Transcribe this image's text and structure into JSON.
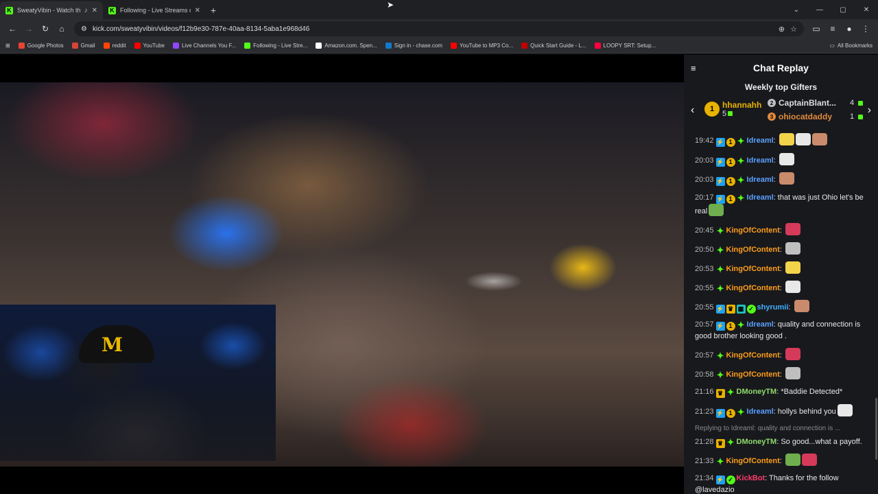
{
  "tabs": [
    {
      "title": "SweatyVibin - Watch the V",
      "active": true
    },
    {
      "title": "Following - Live Streams on Kic",
      "active": false
    }
  ],
  "url": "kick.com/sweatyvibin/videos/f12b9e30-787e-40aa-8134-5aba1e968d46",
  "bookmarks": [
    "Google Photos",
    "Gmail",
    "reddit",
    "YouTube",
    "Live Channels You F...",
    "Following - Live Stre...",
    "Amazon.com. Spen...",
    "Sign in - chase.com",
    "YouTube to MP3 Co...",
    "Quick Start Guide - L...",
    "LOOPY SRT: Setup..."
  ],
  "bookmark_colors": [
    "#ea4335",
    "#d44638",
    "#ff4500",
    "#ff0000",
    "#9146ff",
    "#53fc18",
    "#ffffff",
    "#117aca",
    "#ff0000",
    "#c00000",
    "#ff0040"
  ],
  "all_bookmarks": "All Bookmarks",
  "chat": {
    "title": "Chat Replay",
    "gifters_title": "Weekly top Gifters",
    "gifters": [
      {
        "rank": "1",
        "name": "hhannahh",
        "count": "5",
        "color": "#e8b200"
      },
      {
        "rank": "2",
        "name": "CaptainBlant...",
        "count": "4",
        "color": "#c0c0c0"
      },
      {
        "rank": "3",
        "name": "ohiocatdaddy",
        "count": "1",
        "color": "#e08a3c"
      }
    ],
    "messages": [
      {
        "time": "19:42",
        "badges": [
          "blue",
          "gold",
          "star"
        ],
        "user": "Idreaml",
        "color": "#5aa0ff",
        "text": "",
        "emotes": 3
      },
      {
        "time": "20:03",
        "badges": [
          "blue",
          "gold",
          "star"
        ],
        "user": "Idreaml",
        "color": "#5aa0ff",
        "text": "",
        "emotes": 1
      },
      {
        "time": "20:03",
        "badges": [
          "blue",
          "gold",
          "star"
        ],
        "user": "Idreaml",
        "color": "#5aa0ff",
        "text": "",
        "emotes": 1
      },
      {
        "time": "20:17",
        "badges": [
          "blue",
          "gold",
          "star"
        ],
        "user": "Idreaml",
        "color": "#5aa0ff",
        "text": "that was just Ohio let's be real",
        "emotes": 1
      },
      {
        "time": "20:45",
        "badges": [
          "star"
        ],
        "user": "KingOfContent",
        "color": "#ff9d1a",
        "text": "",
        "emotes": 1
      },
      {
        "time": "20:50",
        "badges": [
          "star"
        ],
        "user": "KingOfContent",
        "color": "#ff9d1a",
        "text": "",
        "emotes": 1
      },
      {
        "time": "20:53",
        "badges": [
          "star"
        ],
        "user": "KingOfContent",
        "color": "#ff9d1a",
        "text": "",
        "emotes": 1
      },
      {
        "time": "20:55",
        "badges": [
          "star"
        ],
        "user": "KingOfContent",
        "color": "#ff9d1a",
        "text": "",
        "emotes": 1
      },
      {
        "time": "20:55",
        "badges": [
          "blue",
          "crown",
          "teal",
          "ver"
        ],
        "user": "shyrumii",
        "color": "#3fb0ff",
        "text": "",
        "emotes": 1
      },
      {
        "time": "20:57",
        "badges": [
          "blue",
          "gold",
          "star"
        ],
        "user": "Idreaml",
        "color": "#5aa0ff",
        "text": "quality and connection is good brother looking good .",
        "emotes": 0
      },
      {
        "time": "20:57",
        "badges": [
          "star"
        ],
        "user": "KingOfContent",
        "color": "#ff9d1a",
        "text": "",
        "emotes": 1
      },
      {
        "time": "20:58",
        "badges": [
          "star"
        ],
        "user": "KingOfContent",
        "color": "#ff9d1a",
        "text": "",
        "emotes": 1
      },
      {
        "time": "21:16",
        "badges": [
          "crown",
          "star"
        ],
        "user": "DMoneyTM",
        "color": "#8fdc6a",
        "text": "*Baddie Detected*",
        "emotes": 0
      },
      {
        "time": "21:23",
        "badges": [
          "blue",
          "gold",
          "star"
        ],
        "user": "Idreaml",
        "color": "#5aa0ff",
        "text": "hollys behind you",
        "emotes": 1
      },
      {
        "time": "21:28",
        "badges": [
          "crown",
          "star"
        ],
        "user": "DMoneyTM",
        "color": "#8fdc6a",
        "text": "So good...what a payoff.",
        "emotes": 0,
        "reply": "Replying to Idreaml: quality and connection is ..."
      },
      {
        "time": "21:33",
        "badges": [
          "star"
        ],
        "user": "KingOfContent",
        "color": "#ff9d1a",
        "text": "",
        "emotes": 2
      },
      {
        "time": "21:34",
        "badges": [
          "blue",
          "ver"
        ],
        "user": "KickBot",
        "color": "#ff3b6b",
        "text": "Thanks for the follow @lavedazio",
        "emotes": 0
      }
    ]
  }
}
